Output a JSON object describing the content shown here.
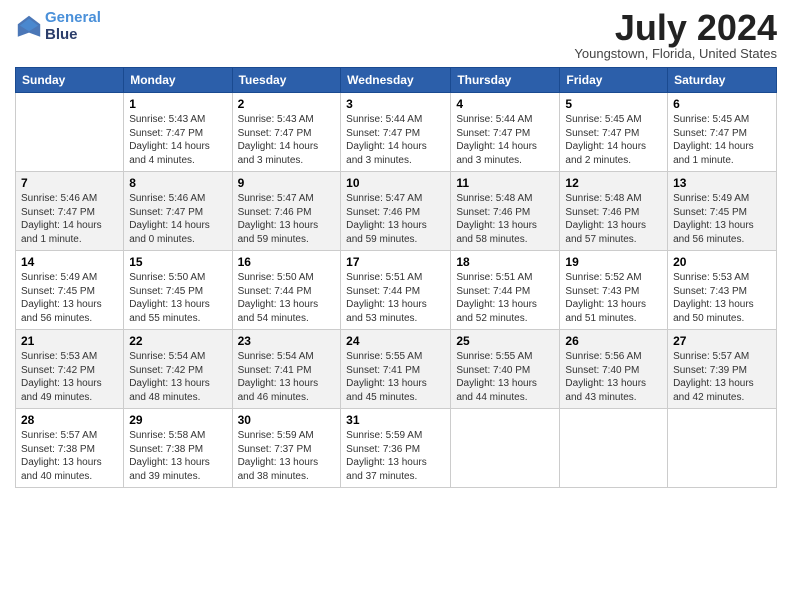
{
  "header": {
    "logo_line1": "General",
    "logo_line2": "Blue",
    "month": "July 2024",
    "location": "Youngstown, Florida, United States"
  },
  "days_of_week": [
    "Sunday",
    "Monday",
    "Tuesday",
    "Wednesday",
    "Thursday",
    "Friday",
    "Saturday"
  ],
  "weeks": [
    [
      {
        "num": "",
        "info": ""
      },
      {
        "num": "1",
        "info": "Sunrise: 5:43 AM\nSunset: 7:47 PM\nDaylight: 14 hours\nand 4 minutes."
      },
      {
        "num": "2",
        "info": "Sunrise: 5:43 AM\nSunset: 7:47 PM\nDaylight: 14 hours\nand 3 minutes."
      },
      {
        "num": "3",
        "info": "Sunrise: 5:44 AM\nSunset: 7:47 PM\nDaylight: 14 hours\nand 3 minutes."
      },
      {
        "num": "4",
        "info": "Sunrise: 5:44 AM\nSunset: 7:47 PM\nDaylight: 14 hours\nand 3 minutes."
      },
      {
        "num": "5",
        "info": "Sunrise: 5:45 AM\nSunset: 7:47 PM\nDaylight: 14 hours\nand 2 minutes."
      },
      {
        "num": "6",
        "info": "Sunrise: 5:45 AM\nSunset: 7:47 PM\nDaylight: 14 hours\nand 1 minute."
      }
    ],
    [
      {
        "num": "7",
        "info": "Sunrise: 5:46 AM\nSunset: 7:47 PM\nDaylight: 14 hours\nand 1 minute."
      },
      {
        "num": "8",
        "info": "Sunrise: 5:46 AM\nSunset: 7:47 PM\nDaylight: 14 hours\nand 0 minutes."
      },
      {
        "num": "9",
        "info": "Sunrise: 5:47 AM\nSunset: 7:46 PM\nDaylight: 13 hours\nand 59 minutes."
      },
      {
        "num": "10",
        "info": "Sunrise: 5:47 AM\nSunset: 7:46 PM\nDaylight: 13 hours\nand 59 minutes."
      },
      {
        "num": "11",
        "info": "Sunrise: 5:48 AM\nSunset: 7:46 PM\nDaylight: 13 hours\nand 58 minutes."
      },
      {
        "num": "12",
        "info": "Sunrise: 5:48 AM\nSunset: 7:46 PM\nDaylight: 13 hours\nand 57 minutes."
      },
      {
        "num": "13",
        "info": "Sunrise: 5:49 AM\nSunset: 7:45 PM\nDaylight: 13 hours\nand 56 minutes."
      }
    ],
    [
      {
        "num": "14",
        "info": "Sunrise: 5:49 AM\nSunset: 7:45 PM\nDaylight: 13 hours\nand 56 minutes."
      },
      {
        "num": "15",
        "info": "Sunrise: 5:50 AM\nSunset: 7:45 PM\nDaylight: 13 hours\nand 55 minutes."
      },
      {
        "num": "16",
        "info": "Sunrise: 5:50 AM\nSunset: 7:44 PM\nDaylight: 13 hours\nand 54 minutes."
      },
      {
        "num": "17",
        "info": "Sunrise: 5:51 AM\nSunset: 7:44 PM\nDaylight: 13 hours\nand 53 minutes."
      },
      {
        "num": "18",
        "info": "Sunrise: 5:51 AM\nSunset: 7:44 PM\nDaylight: 13 hours\nand 52 minutes."
      },
      {
        "num": "19",
        "info": "Sunrise: 5:52 AM\nSunset: 7:43 PM\nDaylight: 13 hours\nand 51 minutes."
      },
      {
        "num": "20",
        "info": "Sunrise: 5:53 AM\nSunset: 7:43 PM\nDaylight: 13 hours\nand 50 minutes."
      }
    ],
    [
      {
        "num": "21",
        "info": "Sunrise: 5:53 AM\nSunset: 7:42 PM\nDaylight: 13 hours\nand 49 minutes."
      },
      {
        "num": "22",
        "info": "Sunrise: 5:54 AM\nSunset: 7:42 PM\nDaylight: 13 hours\nand 48 minutes."
      },
      {
        "num": "23",
        "info": "Sunrise: 5:54 AM\nSunset: 7:41 PM\nDaylight: 13 hours\nand 46 minutes."
      },
      {
        "num": "24",
        "info": "Sunrise: 5:55 AM\nSunset: 7:41 PM\nDaylight: 13 hours\nand 45 minutes."
      },
      {
        "num": "25",
        "info": "Sunrise: 5:55 AM\nSunset: 7:40 PM\nDaylight: 13 hours\nand 44 minutes."
      },
      {
        "num": "26",
        "info": "Sunrise: 5:56 AM\nSunset: 7:40 PM\nDaylight: 13 hours\nand 43 minutes."
      },
      {
        "num": "27",
        "info": "Sunrise: 5:57 AM\nSunset: 7:39 PM\nDaylight: 13 hours\nand 42 minutes."
      }
    ],
    [
      {
        "num": "28",
        "info": "Sunrise: 5:57 AM\nSunset: 7:38 PM\nDaylight: 13 hours\nand 40 minutes."
      },
      {
        "num": "29",
        "info": "Sunrise: 5:58 AM\nSunset: 7:38 PM\nDaylight: 13 hours\nand 39 minutes."
      },
      {
        "num": "30",
        "info": "Sunrise: 5:59 AM\nSunset: 7:37 PM\nDaylight: 13 hours\nand 38 minutes."
      },
      {
        "num": "31",
        "info": "Sunrise: 5:59 AM\nSunset: 7:36 PM\nDaylight: 13 hours\nand 37 minutes."
      },
      {
        "num": "",
        "info": ""
      },
      {
        "num": "",
        "info": ""
      },
      {
        "num": "",
        "info": ""
      }
    ]
  ]
}
